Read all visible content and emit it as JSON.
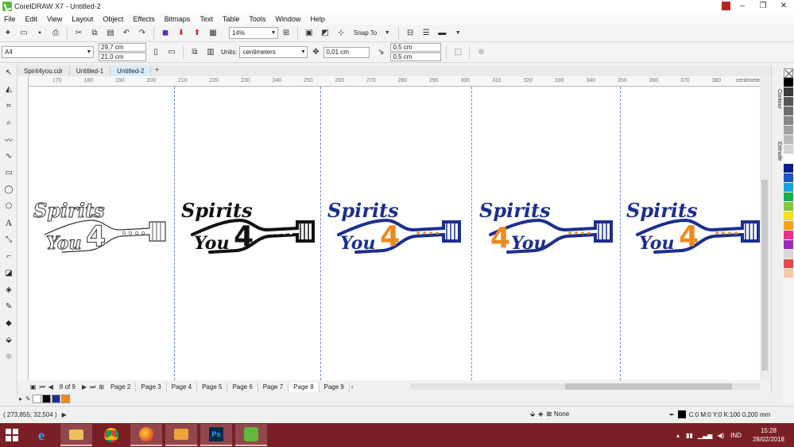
{
  "window": {
    "title": "CorelDRAW X7 - Untitled-2",
    "controls": [
      "–",
      "❐",
      "✕"
    ]
  },
  "menu": [
    "File",
    "Edit",
    "View",
    "Layout",
    "Object",
    "Effects",
    "Bitmaps",
    "Text",
    "Table",
    "Tools",
    "Window",
    "Help"
  ],
  "toolbar": {
    "zoom": "14%",
    "snap_label": "Snap To"
  },
  "properties": {
    "page_size": "A4",
    "width": "29,7 cm",
    "height": "21,0 cm",
    "units_label": "Units:",
    "units_value": "centimeters",
    "nudge": "0,01 cm",
    "dup_x": "0,5 cm",
    "dup_y": "0,5 cm"
  },
  "doc_tabs": [
    "Spirit4you.cdr",
    "Untitled-1",
    "Untitled-2"
  ],
  "ruler": {
    "ticks": [
      "170",
      "180",
      "190",
      "200",
      "210",
      "220",
      "230",
      "240",
      "250",
      "260",
      "270",
      "280",
      "290",
      "300",
      "310",
      "320",
      "330",
      "340",
      "350",
      "360",
      "370",
      "380"
    ],
    "unit": "centimeters"
  },
  "logos": [
    {
      "style": "outline",
      "color": "#333333",
      "accent": "#333333",
      "word1": "Spirits",
      "word2": "You",
      "mark": "4"
    },
    {
      "style": "black",
      "color": "#111111",
      "accent": "#111111",
      "word1": "Spirits",
      "word2": "You",
      "mark": "4"
    },
    {
      "style": "color",
      "color": "#1c2f8f",
      "accent": "#ef8a1f",
      "word1": "Spirits",
      "word2": "You",
      "mark": "4"
    },
    {
      "style": "color-alt",
      "color": "#1c2f8f",
      "accent": "#ef8a1f",
      "word1": "Spirits",
      "word2": "You",
      "mark": "4"
    },
    {
      "style": "color",
      "color": "#1c2f8f",
      "accent": "#ef8a1f",
      "word1": "Spirits",
      "word2": "You",
      "mark": "4"
    }
  ],
  "page_nav": {
    "counter": "8 of 9",
    "pages": [
      "Page 2",
      "Page 3",
      "Page 4",
      "Page 5",
      "Page 6",
      "Page 7",
      "Page 8",
      "Page 9"
    ],
    "active": "Page 8"
  },
  "docker_tabs": [
    "Contour",
    "Extrude"
  ],
  "palette": [
    "#000000",
    "#3a3a3a",
    "#555555",
    "#6e6e6e",
    "#888888",
    "#a1a1a1",
    "#b9b9b9",
    "#d4d4d4",
    "#ffffff",
    "#0b1d8c",
    "#1a56c4",
    "#1aa0e0",
    "#16b14b",
    "#86c440",
    "#f2e21b",
    "#f7a21b",
    "#ea2f8f",
    "#9b2bb7",
    "#d9d9d9",
    "#e24a4a",
    "#f4c9a4"
  ],
  "doc_palette": [
    "#ffffff",
    "#000000",
    "#1c2f8f",
    "#ef8a1f"
  ],
  "status": {
    "cursor": "( 273,855; 32,504 )",
    "fill": "None",
    "outline": "C:0 M:0 Y:0 K:100  0,200 mm"
  },
  "taskbar": {
    "lang": "IND",
    "time": "15:28",
    "date": "28/02/2018"
  }
}
